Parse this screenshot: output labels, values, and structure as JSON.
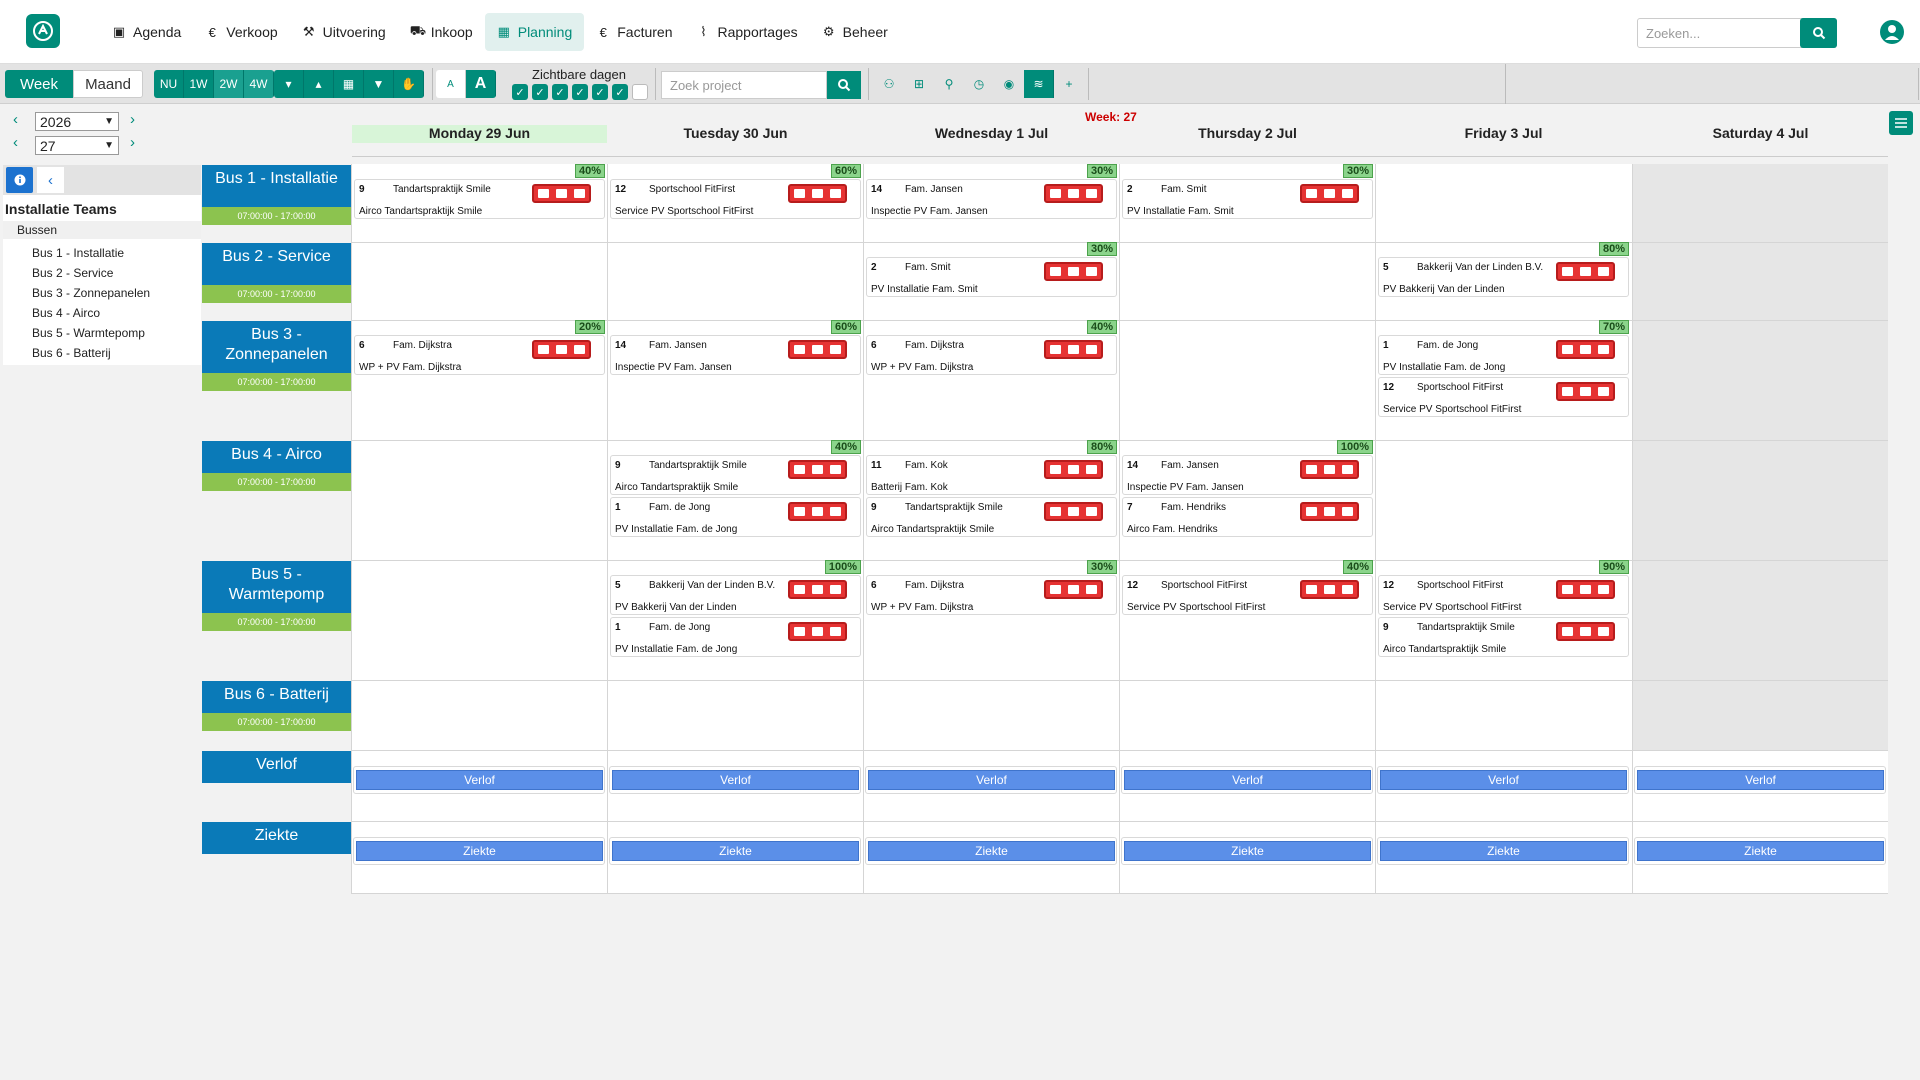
{
  "nav": {
    "items": [
      {
        "label": "Agenda",
        "icon": "calendar-icon"
      },
      {
        "label": "Verkoop",
        "icon": "euro-icon"
      },
      {
        "label": "Uitvoering",
        "icon": "hammer-icon"
      },
      {
        "label": "Inkoop",
        "icon": "cart-icon"
      },
      {
        "label": "Planning",
        "icon": "calendar-grid-icon",
        "active": true
      },
      {
        "label": "Facturen",
        "icon": "euro-icon"
      },
      {
        "label": "Rapportages",
        "icon": "chart-line-icon"
      },
      {
        "label": "Beheer",
        "icon": "gear-icon"
      }
    ],
    "search_placeholder": "Zoeken..."
  },
  "toolbar": {
    "week_label": "Week",
    "maand_label": "Maand",
    "range_buttons": [
      "NU",
      "1W",
      "2W",
      "4W"
    ],
    "font_small": "A",
    "font_large": "A",
    "zichtbare_dagen_label": "Zichtbare dagen",
    "visible_days": [
      true,
      true,
      true,
      true,
      true,
      true,
      false
    ],
    "project_search_placeholder": "Zoek project"
  },
  "selectors": {
    "year": "2026",
    "week": "27"
  },
  "week_label": "Week: 27",
  "days": [
    {
      "label": "Monday 29 Jun",
      "today": true
    },
    {
      "label": "Tuesday 30 Jun"
    },
    {
      "label": "Wednesday 1 Jul"
    },
    {
      "label": "Thursday 2 Jul"
    },
    {
      "label": "Friday 3 Jul"
    },
    {
      "label": "Saturday 4 Jul"
    }
  ],
  "left_panel": {
    "title": "Installatie Teams",
    "group": "Bussen",
    "items": [
      "Bus 1 - Installatie",
      "Bus 2 - Service",
      "Bus 3 - Zonnepanelen",
      "Bus 4 - Airco",
      "Bus 5 - Warmtepomp",
      "Bus 6 - Batterij"
    ]
  },
  "resources": [
    {
      "name": "Bus 1 - Installatie",
      "time": "07:00:00 - 17:00:00"
    },
    {
      "name": "Bus 2 - Service",
      "time": "07:00:00 - 17:00:00"
    },
    {
      "name": "Bus 3 - Zonnepanelen",
      "time": "07:00:00 - 17:00:00"
    },
    {
      "name": "Bus 4 - Airco",
      "time": "07:00:00 - 17:00:00"
    },
    {
      "name": "Bus 5 - Warmtepomp",
      "time": "07:00:00 - 17:00:00"
    },
    {
      "name": "Bus 6 - Batterij",
      "time": "07:00:00 - 17:00:00"
    },
    {
      "name": "Verlof",
      "time": ""
    },
    {
      "name": "Ziekte",
      "time": ""
    }
  ],
  "assignments": [
    {
      "row": 0,
      "day": 0,
      "pct": "40%",
      "cards": [
        {
          "num": "9",
          "name": "Tandartspraktijk Smile",
          "desc": "Airco Tandartspraktijk Smile"
        }
      ]
    },
    {
      "row": 0,
      "day": 1,
      "pct": "60%",
      "cards": [
        {
          "num": "12",
          "name": "Sportschool FitFirst",
          "desc": "Service PV Sportschool FitFirst"
        }
      ]
    },
    {
      "row": 0,
      "day": 2,
      "pct": "30%",
      "cards": [
        {
          "num": "14",
          "name": "Fam. Jansen",
          "desc": "Inspectie PV Fam. Jansen"
        }
      ]
    },
    {
      "row": 0,
      "day": 3,
      "pct": "30%",
      "cards": [
        {
          "num": "2",
          "name": "Fam. Smit",
          "desc": "PV Installatie Fam. Smit"
        }
      ]
    },
    {
      "row": 1,
      "day": 2,
      "pct": "30%",
      "cards": [
        {
          "num": "2",
          "name": "Fam. Smit",
          "desc": "PV Installatie Fam. Smit"
        }
      ]
    },
    {
      "row": 1,
      "day": 4,
      "pct": "80%",
      "cards": [
        {
          "num": "5",
          "name": "Bakkerij Van der Linden B.V.",
          "desc": "PV Bakkerij Van der Linden"
        }
      ]
    },
    {
      "row": 2,
      "day": 0,
      "pct": "20%",
      "cards": [
        {
          "num": "6",
          "name": "Fam. Dijkstra",
          "desc": "WP + PV Fam. Dijkstra"
        }
      ]
    },
    {
      "row": 2,
      "day": 1,
      "pct": "60%",
      "cards": [
        {
          "num": "14",
          "name": "Fam. Jansen",
          "desc": "Inspectie PV Fam. Jansen"
        }
      ]
    },
    {
      "row": 2,
      "day": 2,
      "pct": "40%",
      "cards": [
        {
          "num": "6",
          "name": "Fam. Dijkstra",
          "desc": "WP + PV Fam. Dijkstra"
        }
      ]
    },
    {
      "row": 2,
      "day": 4,
      "pct": "70%",
      "cards": [
        {
          "num": "1",
          "name": "Fam. de Jong",
          "desc": "PV Installatie Fam. de Jong"
        },
        {
          "num": "12",
          "name": "Sportschool FitFirst",
          "desc": "Service PV Sportschool FitFirst"
        }
      ]
    },
    {
      "row": 3,
      "day": 1,
      "pct": "40%",
      "cards": [
        {
          "num": "9",
          "name": "Tandartspraktijk Smile",
          "desc": "Airco Tandartspraktijk Smile"
        },
        {
          "num": "1",
          "name": "Fam. de Jong",
          "desc": "PV Installatie Fam. de Jong"
        }
      ]
    },
    {
      "row": 3,
      "day": 2,
      "pct": "80%",
      "cards": [
        {
          "num": "11",
          "name": "Fam. Kok",
          "desc": "Batterij Fam. Kok"
        },
        {
          "num": "9",
          "name": "Tandartspraktijk Smile",
          "desc": "Airco Tandartspraktijk Smile"
        }
      ]
    },
    {
      "row": 3,
      "day": 3,
      "pct": "100%",
      "cards": [
        {
          "num": "14",
          "name": "Fam. Jansen",
          "desc": "Inspectie PV Fam. Jansen"
        },
        {
          "num": "7",
          "name": "Fam. Hendriks",
          "desc": "Airco Fam. Hendriks"
        }
      ]
    },
    {
      "row": 4,
      "day": 1,
      "pct": "100%",
      "cards": [
        {
          "num": "5",
          "name": "Bakkerij Van der Linden B.V.",
          "desc": "PV Bakkerij Van der Linden"
        },
        {
          "num": "1",
          "name": "Fam. de Jong",
          "desc": "PV Installatie Fam. de Jong"
        }
      ]
    },
    {
      "row": 4,
      "day": 2,
      "pct": "30%",
      "cards": [
        {
          "num": "6",
          "name": "Fam. Dijkstra",
          "desc": "WP + PV Fam. Dijkstra"
        }
      ]
    },
    {
      "row": 4,
      "day": 3,
      "pct": "40%",
      "cards": [
        {
          "num": "12",
          "name": "Sportschool FitFirst",
          "desc": "Service PV Sportschool FitFirst"
        }
      ]
    },
    {
      "row": 4,
      "day": 4,
      "pct": "90%",
      "cards": [
        {
          "num": "12",
          "name": "Sportschool FitFirst",
          "desc": "Service PV Sportschool FitFirst"
        },
        {
          "num": "9",
          "name": "Tandartspraktijk Smile",
          "desc": "Airco Tandartspraktijk Smile"
        }
      ]
    }
  ],
  "leave_label": "Verlof",
  "sick_label": "Ziekte",
  "colors": {
    "primary": "#008c7a",
    "resource": "#0a7ab8",
    "time": "#8cc34f",
    "danger": "#e63333",
    "leave": "#5b8fe8"
  }
}
